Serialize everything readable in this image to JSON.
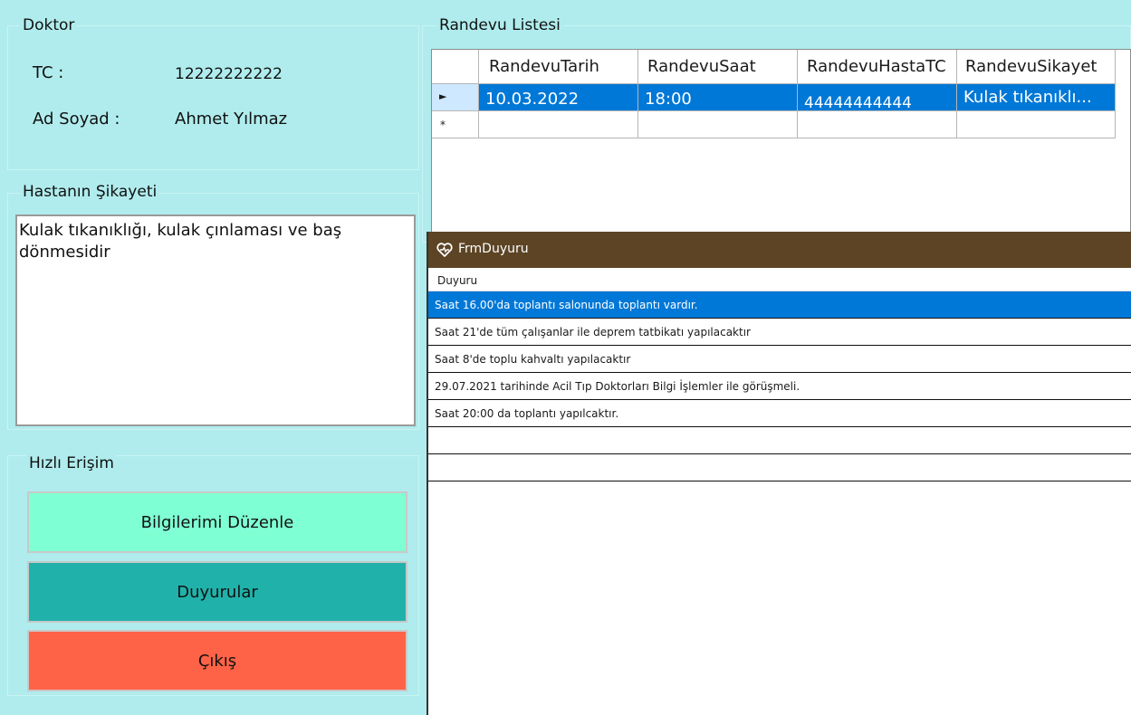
{
  "doctor": {
    "group_title": "Doktor",
    "tc_label": "TC :",
    "tc_value": "12222222222",
    "name_label": "Ad Soyad :",
    "name_value": "Ahmet Yılmaz"
  },
  "complaint": {
    "group_title": "Hastanın Şikayeti",
    "text": "Kulak tıkanıklığı, kulak çınlaması ve baş dönmesidir"
  },
  "quick_access": {
    "title": "Hızlı Erişim",
    "buttons": [
      {
        "label": "Bilgilerimi Düzenle",
        "color": "#7fffd4"
      },
      {
        "label": "Duyurular",
        "color": "#20b2aa"
      },
      {
        "label": "Çıkış",
        "color": "#ff6347"
      }
    ]
  },
  "appointments": {
    "title": "Randevu Listesi",
    "columns": [
      "RandevuTarih",
      "RandevuSaat",
      "RandevuHastaTC",
      "RandevuSikayet"
    ],
    "rows": [
      [
        "10.03.2022",
        "18:00",
        "44444444444",
        "Kulak tıkanıklı..."
      ]
    ],
    "new_row_marker": "*"
  },
  "announcement_window": {
    "title": "FrmDuyuru",
    "column": "Duyuru",
    "items": [
      "Saat 16.00'da toplantı salonunda toplantı vardır.",
      "Saat 21'de tüm çalışanlar ile deprem tatbikatı yapılacaktır",
      "Saat 8'de toplu kahvaltı yapılacaktır",
      "29.07.2021 tarihinde Acil Tıp Doktorları Bilgi İşlemler ile görüşmeli.",
      "Saat 20:00 da toplantı yapılcaktır."
    ],
    "selected_index": 0
  },
  "colors": {
    "background": "#b0eced",
    "selection": "#0078d7",
    "titlebar": "#5c4424"
  }
}
